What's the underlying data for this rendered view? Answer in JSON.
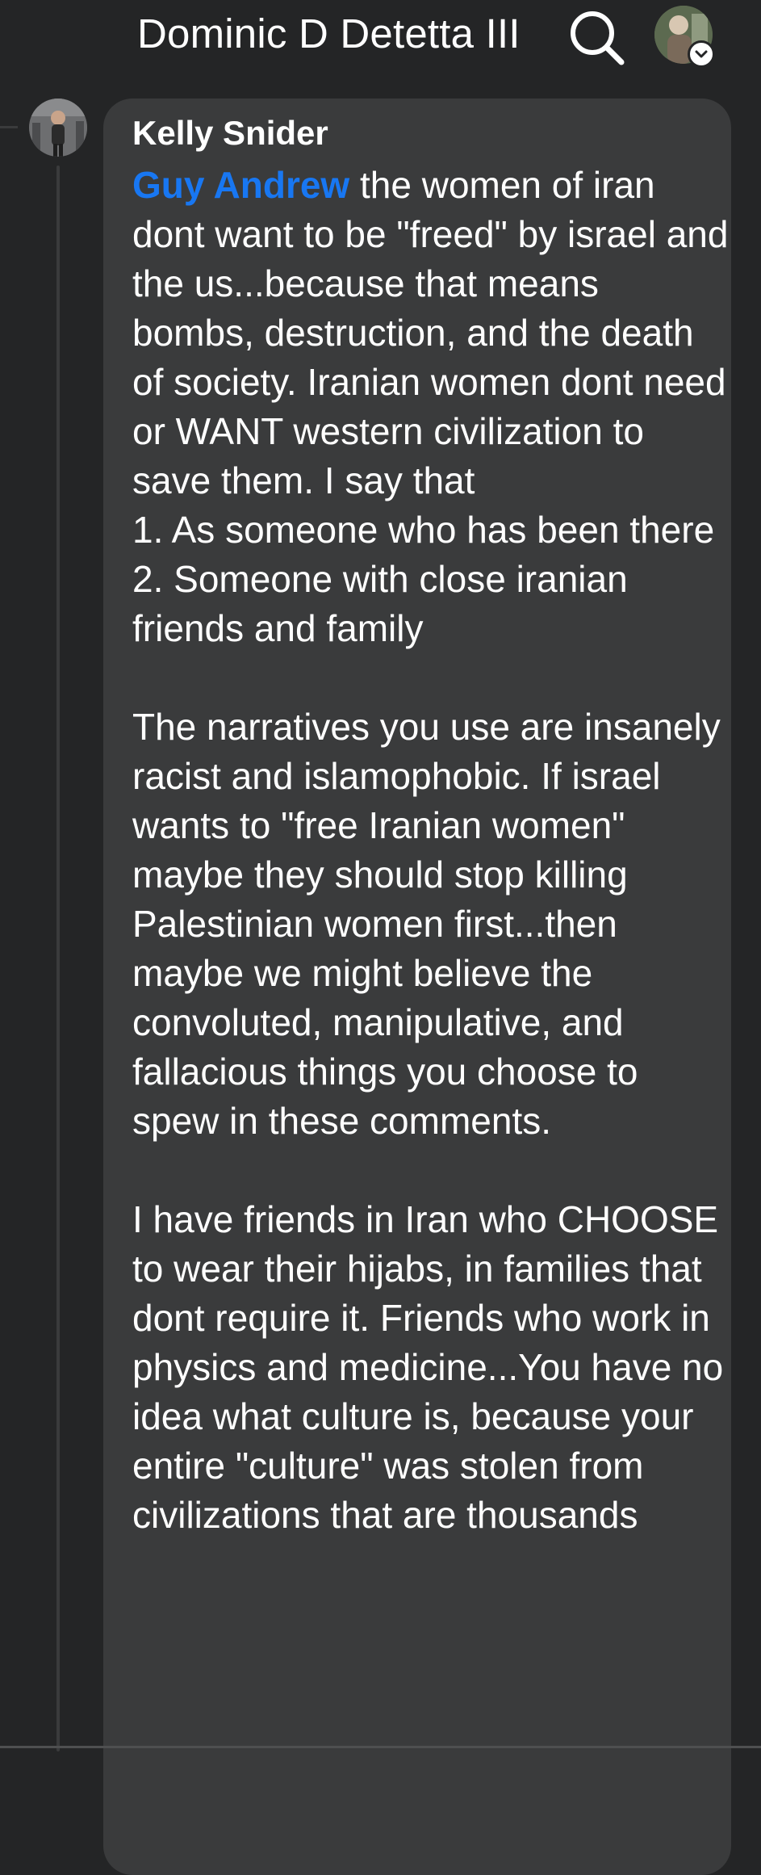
{
  "header": {
    "title": "Dominic D Detetta III"
  },
  "comment": {
    "author": "Kelly Snider",
    "mention": "Guy Andrew",
    "text_after_mention": " the women of iran dont want to be \"freed\" by israel and the us...because that means bombs, destruction, and the death of society. Iranian women dont need or WANT western civilization to save them. I say that\n 1. As someone who has been there\n2. Someone with close iranian friends and family\n\nThe narratives you use are insanely racist and islamophobic. If israel wants to \"free Iranian women\" maybe they should stop killing Palestinian women first...then maybe we might believe the convoluted, manipulative, and fallacious things you choose to spew in these comments.\n\nI have friends in Iran who CHOOSE to wear their hijabs, in families that dont require it. Friends who work in physics and medicine...You have no idea what culture is, because your entire \"culture\" was stolen from civilizations that are thousands"
  },
  "colors": {
    "background": "#242526",
    "bubble": "#3a3b3c",
    "text": "#ffffff",
    "mention": "#1877f2"
  },
  "icons": {
    "search": "search-icon",
    "profile": "profile-avatar",
    "chevron": "chevron-down-icon"
  }
}
